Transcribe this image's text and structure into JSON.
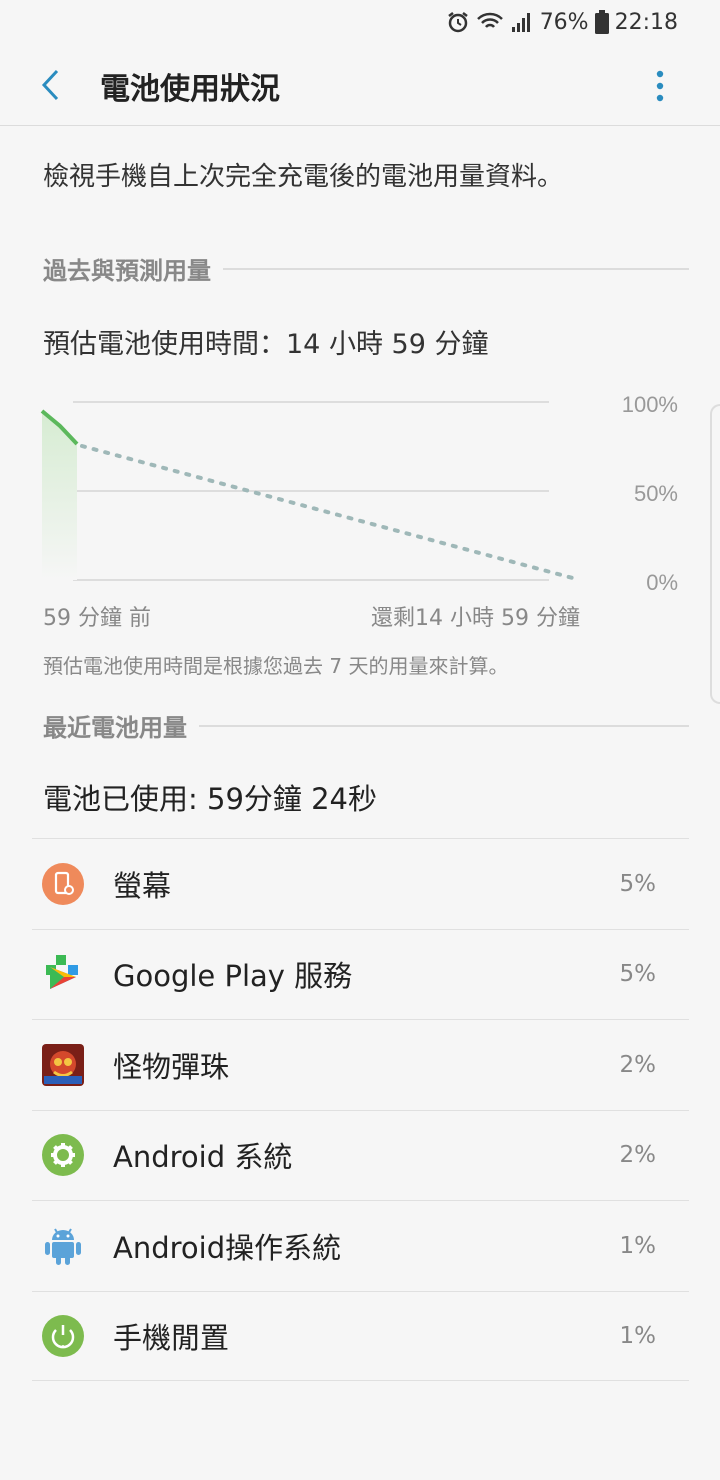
{
  "status_bar": {
    "battery_percent": "76%",
    "time": "22:18",
    "icons": [
      "alarm-icon",
      "wifi-icon",
      "signal-icon",
      "battery-icon"
    ]
  },
  "header": {
    "title": "電池使用狀況"
  },
  "description": "檢視手機自上次完全充電後的電池用量資料。",
  "section_past_predicted": "過去與預測用量",
  "estimate_text": "預估電池使用時間：14 小時 59 分鐘",
  "chart": {
    "y_ticks": [
      "100%",
      "50%",
      "0%"
    ],
    "x_start_label": "59 分鐘 前",
    "x_end_label": "還剩14 小時 59 分鐘",
    "note": "預估電池使用時間是根據您過去 7 天的用量來計算。",
    "accent_color": "#5cb85c",
    "prediction_color": "#9fb8b8"
  },
  "section_recent": "最近電池用量",
  "battery_used": "電池已使用: 59分鐘 24秒",
  "usage_items": [
    {
      "name": "螢幕",
      "percent": "5%",
      "icon": "screen-icon"
    },
    {
      "name": "Google Play 服務",
      "percent": "5%",
      "icon": "google-play-services-icon"
    },
    {
      "name": "怪物彈珠",
      "percent": "2%",
      "icon": "monster-strike-icon"
    },
    {
      "name": "Android 系統",
      "percent": "2%",
      "icon": "android-system-gear-icon"
    },
    {
      "name": "Android操作系統",
      "percent": "1%",
      "icon": "android-robot-icon"
    },
    {
      "name": "手機閒置",
      "percent": "1%",
      "icon": "phone-idle-power-icon"
    }
  ]
}
